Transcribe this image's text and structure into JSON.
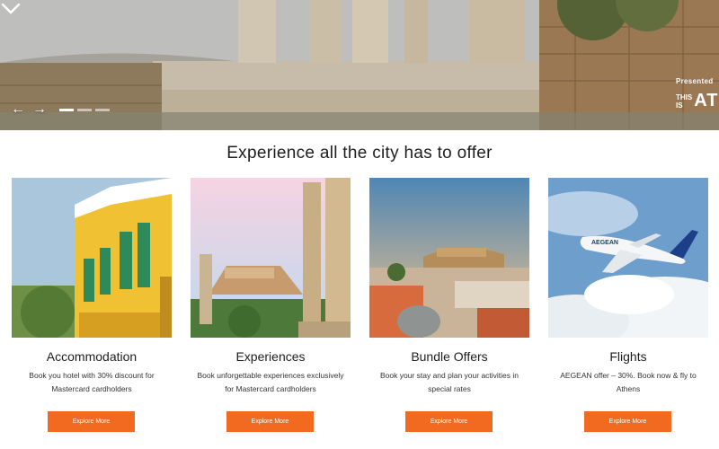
{
  "hero": {
    "prev_icon": "arrow-left-icon",
    "next_icon": "arrow-right-icon",
    "slides": [
      true,
      false,
      false
    ],
    "scroll_icon": "chevron-down-icon",
    "promo": {
      "presented": "Presented",
      "logo_small": "THIS\nIS",
      "logo_big": "AT"
    }
  },
  "section": {
    "title": "Experience all the city has to offer"
  },
  "cards": [
    {
      "title": "Accommodation",
      "description": "Book you hotel with 30% discount for Mastercard cardholders",
      "button": "Explore More"
    },
    {
      "title": "Experiences",
      "description": "Book unforgettable experiences exclusively for Mastercard cardholders",
      "button": "Explore More"
    },
    {
      "title": "Bundle Offers",
      "description": "Book your stay and plan your activities in special rates",
      "button": "Explore More"
    },
    {
      "title": "Flights",
      "description": "AEGEAN offer – 30%. Book now & fly to Athens",
      "button": "Explore More",
      "plane_livery": "AEGEAN"
    }
  ],
  "colors": {
    "accent": "#f26a1f",
    "heading": "#1e1e1e"
  }
}
